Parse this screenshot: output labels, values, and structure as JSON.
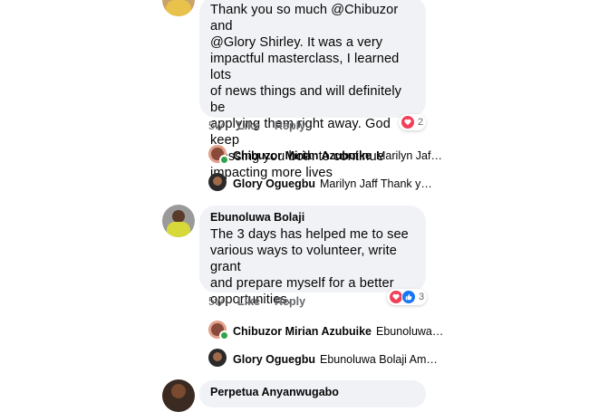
{
  "comments": [
    {
      "text_lines": [
        "Thank you so much @Chibuzor and",
        "@Glory Shirley. It was a very",
        "impactful masterclass, I learned lots",
        "of news things and will definitely be",
        "applying them right away. God keep",
        "blessing you both to continue",
        "impacting more lives"
      ],
      "time": "5w",
      "like_label": "Like",
      "reply_label": "Reply",
      "reactions": {
        "types": [
          "love-icon"
        ],
        "count": "2",
        "colors": [
          "#f33e58"
        ]
      },
      "replies": [
        {
          "name": "Chibuzor Mirian Azubuike",
          "snippet": "Marilyn Jaf…"
        },
        {
          "name": "Glory Oguegbu",
          "snippet": "Marilyn Jaff Thank you …"
        }
      ]
    },
    {
      "author": "Ebunoluwa Bolaji",
      "text_lines": [
        "The 3 days has helped me to see",
        "various ways to volunteer, write grant",
        "and prepare myself for a better",
        "opportunities."
      ],
      "time": "5w",
      "like_label": "Like",
      "reply_label": "Reply",
      "reactions": {
        "types": [
          "love-icon",
          "like-icon"
        ],
        "count": "3",
        "colors": [
          "#f33e58",
          "#1877f2"
        ]
      },
      "replies": [
        {
          "name": "Chibuzor Mirian Azubuike",
          "snippet": "Ebunoluwa…"
        },
        {
          "name": "Glory Oguegbu",
          "snippet": "Ebunoluwa Bolaji Amaz…"
        }
      ]
    }
  ],
  "next_comment_author_partial": "Perpetua Anyanwugabo"
}
